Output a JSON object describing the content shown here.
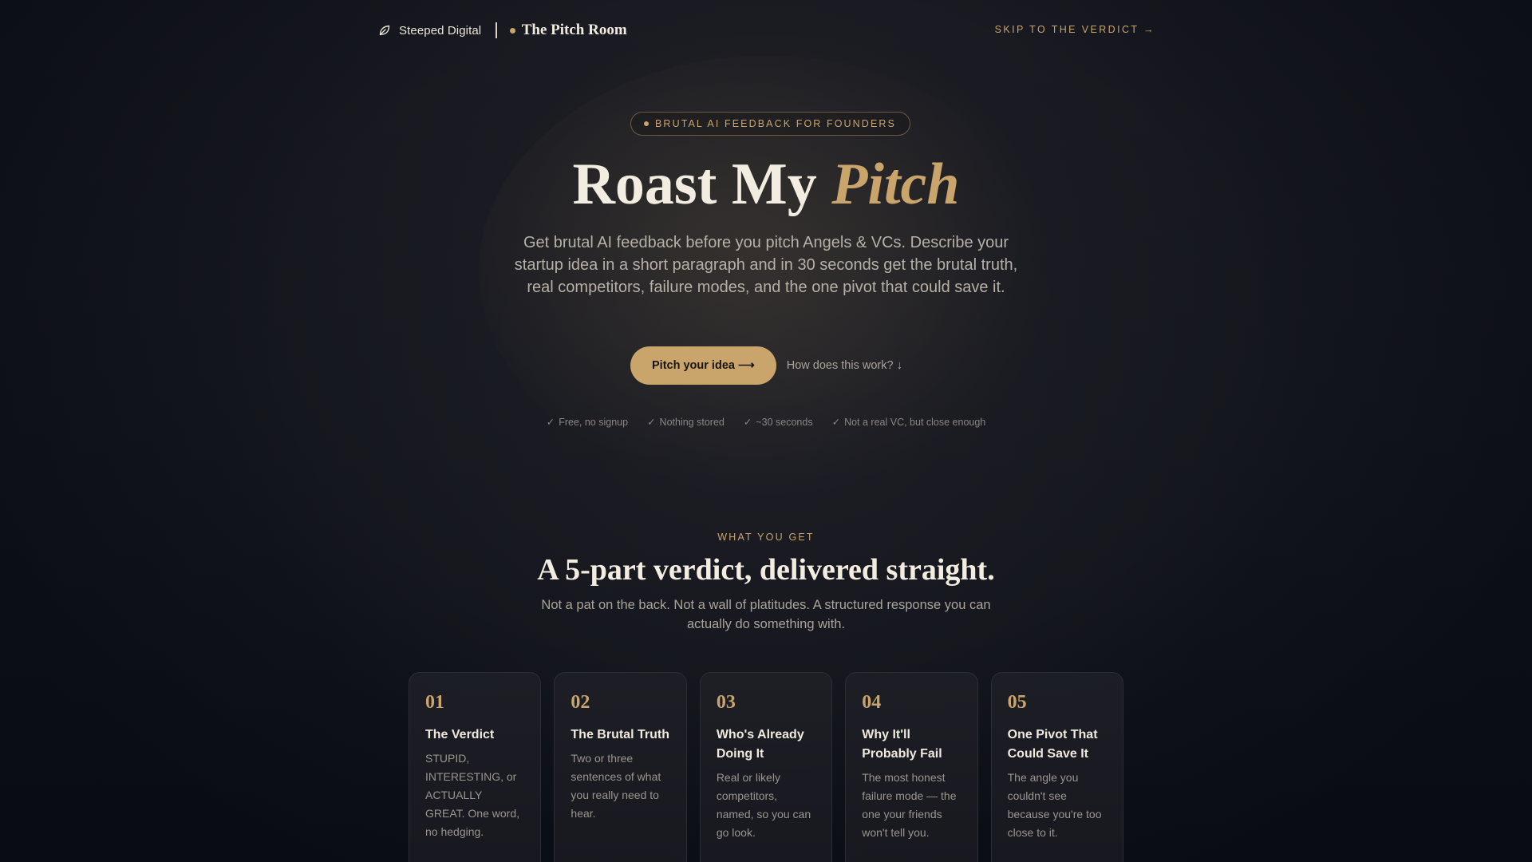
{
  "header": {
    "brand_name": "Steeped Digital",
    "room_name": "The Pitch Room",
    "skip_link": "SKIP TO THE VERDICT →"
  },
  "hero": {
    "badge": "BRUTAL AI FEEDBACK FOR FOUNDERS",
    "title_main": "Roast My ",
    "title_accent": "Pitch",
    "subtitle": "Get brutal AI feedback before you pitch Angels & VCs. Describe your startup idea in a short paragraph and in 30 seconds get the brutal truth, real competitors, failure modes, and the one pivot that could save it.",
    "cta_primary": "Pitch your idea ⟶",
    "cta_secondary": "How does this work? ↓",
    "perks": [
      {
        "check": "✓",
        "label": "Free, no signup"
      },
      {
        "check": "✓",
        "label": "Nothing stored"
      },
      {
        "check": "✓",
        "label": "~30 seconds"
      },
      {
        "check": "✓",
        "label": "Not a real VC, but close enough"
      }
    ]
  },
  "section": {
    "eyebrow": "WHAT YOU GET",
    "title": "A 5-part verdict, delivered straight.",
    "subtitle": "Not a pat on the back. Not a wall of platitudes. A structured response you can actually do something with.",
    "cards": [
      {
        "num": "01",
        "title": "The Verdict",
        "desc": "STUPID, INTERESTING, or ACTUALLY GREAT. One word, no hedging."
      },
      {
        "num": "02",
        "title": "The Brutal Truth",
        "desc": "Two or three sentences of what you really need to hear."
      },
      {
        "num": "03",
        "title": "Who's Already Doing It",
        "desc": "Real or likely competitors, named, so you can go look."
      },
      {
        "num": "04",
        "title": "Why It'll Probably Fail",
        "desc": "The most honest failure mode — the one your friends won't tell you."
      },
      {
        "num": "05",
        "title": "One Pivot That Could Save It",
        "desc": "The angle you couldn't see because you're too close to it."
      }
    ]
  },
  "colors": {
    "background": "#13151c",
    "accent_gold": "#c9a56b",
    "text_primary": "#f3ede1",
    "text_muted": "#aaa49b",
    "card_border": "#2b2d35"
  },
  "icons": {
    "brand": "leaf-icon"
  }
}
